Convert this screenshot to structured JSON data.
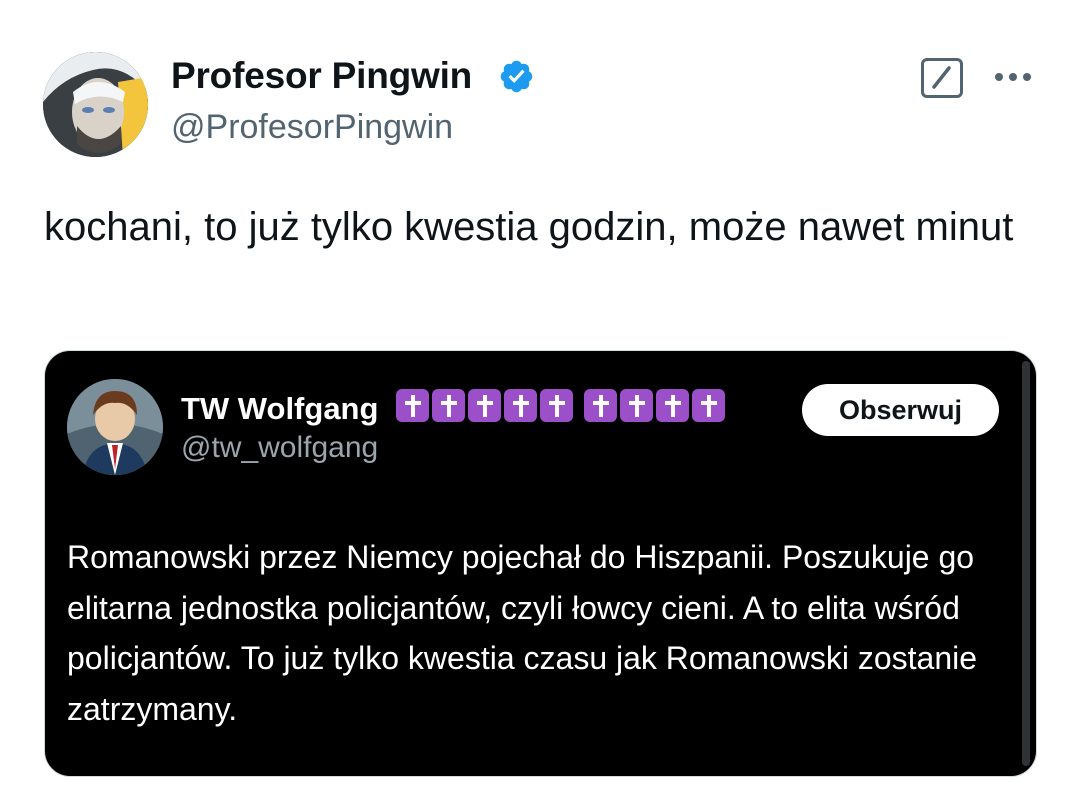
{
  "tweet": {
    "author": {
      "display_name": "Profesor Pingwin",
      "handle": "@ProfesorPingwin",
      "verified": true
    },
    "text": "kochani, to już tylko kwestia godzin, może nawet minut",
    "icons": {
      "grok": "grok-icon",
      "more": "more-options-icon",
      "verified": "verified-badge-icon"
    }
  },
  "embedded": {
    "author": {
      "display_name": "TW Wolfgang",
      "handle": "@tw_wolfgang",
      "emoji": "✝✝✝✝✝✝✝✝✝"
    },
    "follow_label": "Obserwuj",
    "text": "Romanowski przez Niemcy pojechał do Hiszpanii. Poszukuje go elitarna jednostka policjantów, czyli łowcy cieni. A to elita wśród policjantów. To już tylko kwestia czasu jak Romanowski zostanie zatrzymany."
  },
  "colors": {
    "verified": "#1d9bf0",
    "cross_badge": "#9b4fc8",
    "secondary_text": "#536471"
  }
}
